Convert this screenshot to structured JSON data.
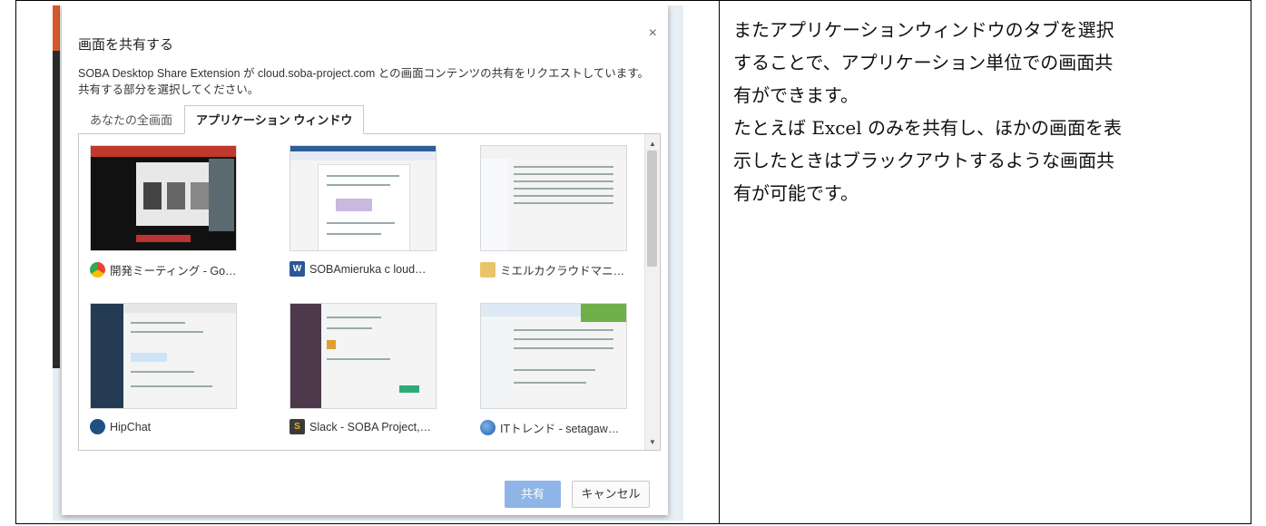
{
  "dialog": {
    "title": "画面を共有する",
    "description": "SOBA Desktop Share Extension が cloud.soba-project.com との画面コンテンツの共有をリクエストしています。共有する部分を選択してください。",
    "close_label": "×",
    "tabs": [
      {
        "label": "あなたの全画面",
        "active": false
      },
      {
        "label": "アプリケーション ウィンドウ",
        "active": true
      }
    ],
    "windows": [
      {
        "label": "開発ミーティング - Go…",
        "icon": "chrome-icon"
      },
      {
        "label": "SOBAmieruka c loud…",
        "icon": "word-icon"
      },
      {
        "label": "ミエルカクラウドマニ…",
        "icon": "folder-icon"
      },
      {
        "label": "HipChat",
        "icon": "hipchat-icon"
      },
      {
        "label": "Slack - SOBA Project,…",
        "icon": "slack-icon"
      },
      {
        "label": "ITトレンド - setagaw…",
        "icon": "thunderbird-icon"
      }
    ],
    "share_label": "共有",
    "cancel_label": "キャンセル"
  },
  "note": {
    "lines": [
      "またアプリケーションウィンドウのタブを選択",
      "することで、アプリケーション単位での画面共",
      "有ができます。",
      "たとえば Excel のみを共有し、ほかの画面を表",
      "示したときはブラックアウトするような画面共",
      "有が可能です。"
    ]
  },
  "colors": {
    "share_button": "#8fb5e8",
    "tab_border": "#c8c8c8",
    "accent_orange": "#d65a2c"
  }
}
